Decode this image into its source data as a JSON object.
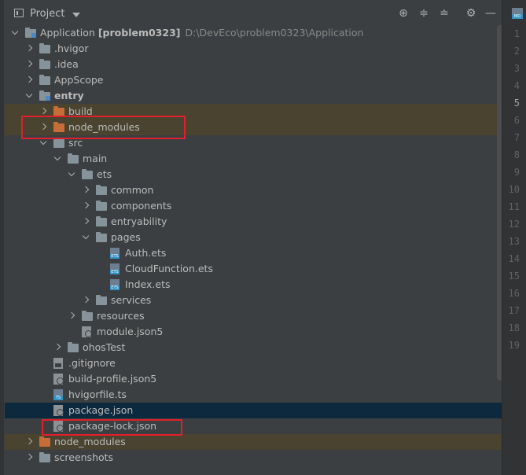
{
  "panel": {
    "title": "Project"
  },
  "toolbar": {
    "locate_icon": "crosshair-icon",
    "expand_icon": "expand-all-icon",
    "collapse_icon": "collapse-all-icon",
    "settings_icon": "gear-icon",
    "hide_icon": "minimize-icon"
  },
  "tree": [
    {
      "depth": 0,
      "arrow": "down",
      "icon": "module",
      "label": "Application",
      "bracket": "[problem0323]",
      "path": "D:\\DevEco\\problem0323\\Application",
      "bold": false
    },
    {
      "depth": 1,
      "arrow": "right",
      "icon": "folder",
      "label": ".hvigor"
    },
    {
      "depth": 1,
      "arrow": "right",
      "icon": "folder",
      "label": ".idea"
    },
    {
      "depth": 1,
      "arrow": "right",
      "icon": "folder",
      "label": "AppScope"
    },
    {
      "depth": 1,
      "arrow": "down",
      "icon": "module",
      "label": "entry",
      "bold": true
    },
    {
      "depth": 2,
      "arrow": "right",
      "icon": "orange",
      "label": "build",
      "hl": true
    },
    {
      "depth": 2,
      "arrow": "right",
      "icon": "orange",
      "label": "node_modules",
      "hl": true
    },
    {
      "depth": 2,
      "arrow": "down",
      "icon": "folder",
      "label": "src"
    },
    {
      "depth": 3,
      "arrow": "down",
      "icon": "folder",
      "label": "main"
    },
    {
      "depth": 4,
      "arrow": "down",
      "icon": "folder",
      "label": "ets"
    },
    {
      "depth": 5,
      "arrow": "right",
      "icon": "folder",
      "label": "common"
    },
    {
      "depth": 5,
      "arrow": "right",
      "icon": "folder",
      "label": "components"
    },
    {
      "depth": 5,
      "arrow": "right",
      "icon": "folder",
      "label": "entryability"
    },
    {
      "depth": 5,
      "arrow": "down",
      "icon": "folder",
      "label": "pages"
    },
    {
      "depth": 6,
      "arrow": "none",
      "icon": "ets",
      "label": "Auth.ets"
    },
    {
      "depth": 6,
      "arrow": "none",
      "icon": "ets",
      "label": "CloudFunction.ets"
    },
    {
      "depth": 6,
      "arrow": "none",
      "icon": "ets",
      "label": "Index.ets"
    },
    {
      "depth": 5,
      "arrow": "right",
      "icon": "folder",
      "label": "services"
    },
    {
      "depth": 4,
      "arrow": "right",
      "icon": "folder",
      "label": "resources"
    },
    {
      "depth": 4,
      "arrow": "none",
      "icon": "json",
      "label": "module.json5"
    },
    {
      "depth": 3,
      "arrow": "right",
      "icon": "folder",
      "label": "ohosTest"
    },
    {
      "depth": 2,
      "arrow": "none",
      "icon": "git",
      "label": ".gitignore"
    },
    {
      "depth": 2,
      "arrow": "none",
      "icon": "json",
      "label": "build-profile.json5"
    },
    {
      "depth": 2,
      "arrow": "none",
      "icon": "ts",
      "label": "hvigorfile.ts"
    },
    {
      "depth": 2,
      "arrow": "none",
      "icon": "json",
      "label": "package.json",
      "sel": true
    },
    {
      "depth": 2,
      "arrow": "none",
      "icon": "json",
      "label": "package-lock.json"
    },
    {
      "depth": 1,
      "arrow": "right",
      "icon": "orange",
      "label": "node_modules",
      "hl": true
    },
    {
      "depth": 1,
      "arrow": "right",
      "icon": "folder",
      "label": "screenshots"
    }
  ],
  "gutter": {
    "lines": [
      "1",
      "2",
      "3",
      "4",
      "5",
      "6",
      "7",
      "8",
      "9",
      "10",
      "11",
      "12",
      "13",
      "14",
      "15",
      "16",
      "17",
      "18",
      "19"
    ],
    "current_line": "5"
  },
  "colors": {
    "highlight_box": "#e0202a",
    "selection": "#0d293e",
    "excluded_row": "#49432f"
  }
}
